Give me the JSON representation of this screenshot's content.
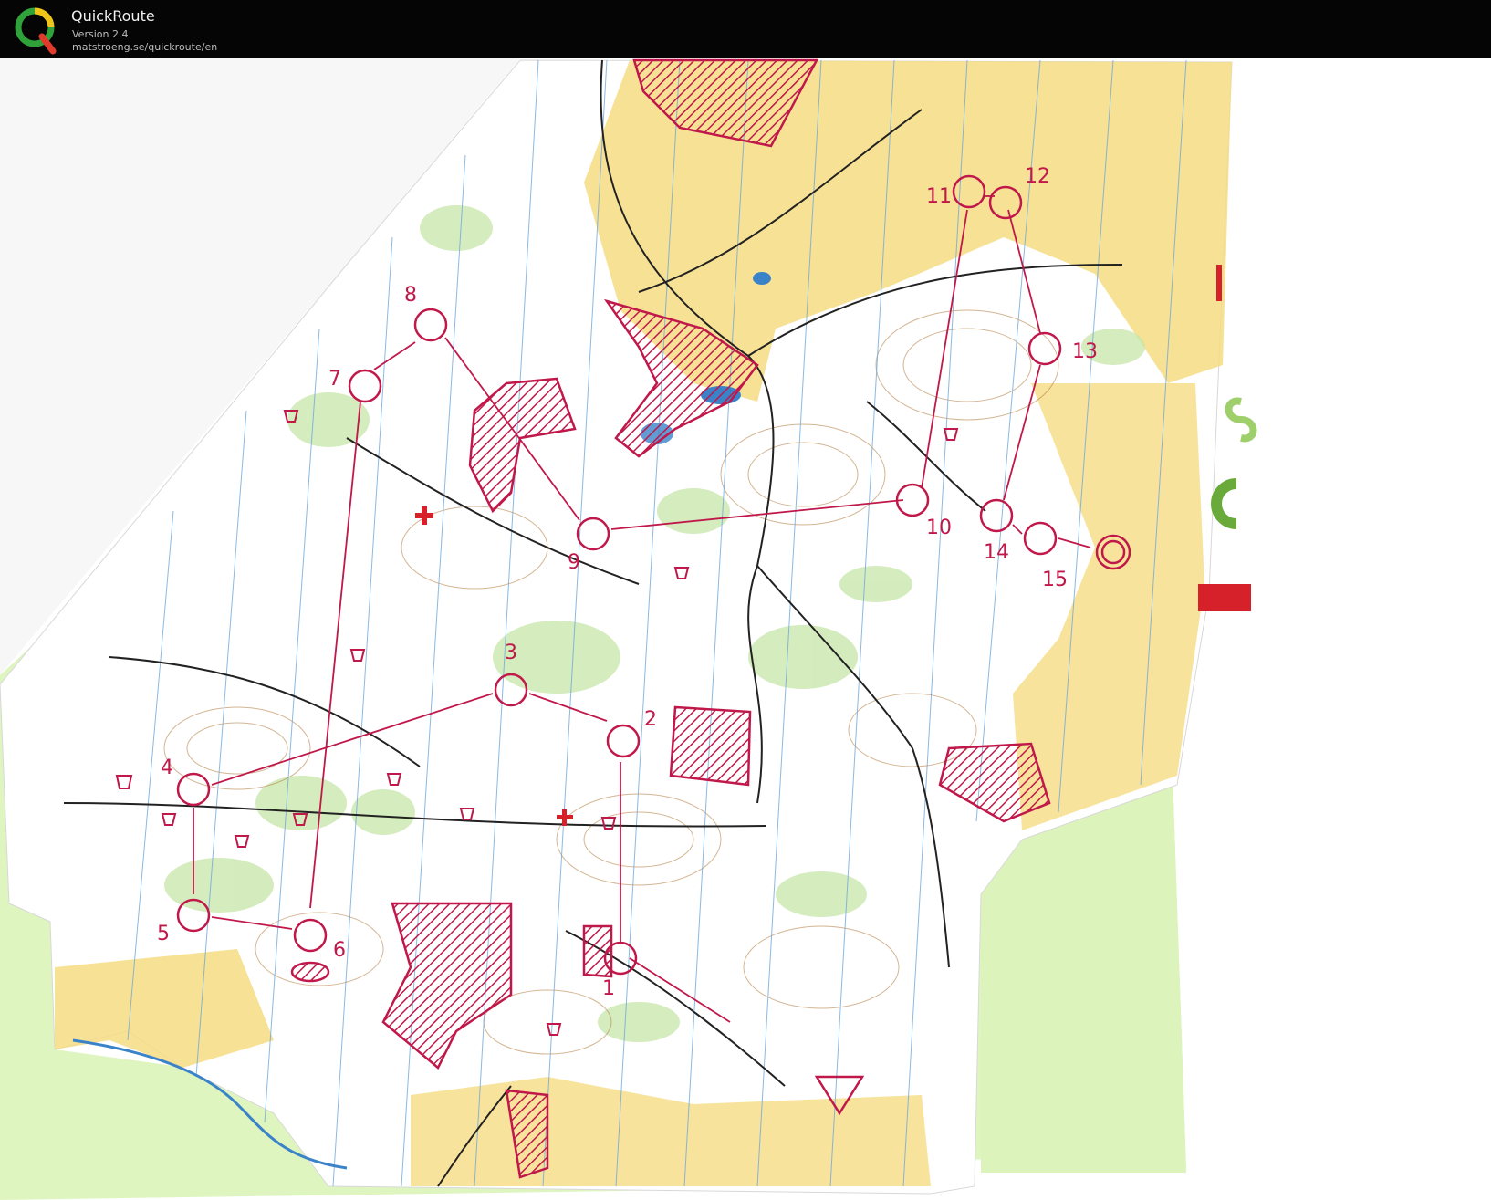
{
  "app": {
    "name": "QuickRoute",
    "version": "Version 2.4",
    "url": "matstroeng.se/quickroute/en",
    "logo_letter": "Q"
  },
  "map": {
    "course_color": "#c0184a",
    "forest_color": "#ffffff",
    "open_land_color": "#f5dc82",
    "vegetation_color": "#c6e6a8",
    "background_green": "#dff5c0",
    "control_labels": [
      "1",
      "2",
      "3",
      "4",
      "5",
      "6",
      "7",
      "8",
      "9",
      "10",
      "11",
      "12",
      "13",
      "14",
      "15"
    ]
  }
}
